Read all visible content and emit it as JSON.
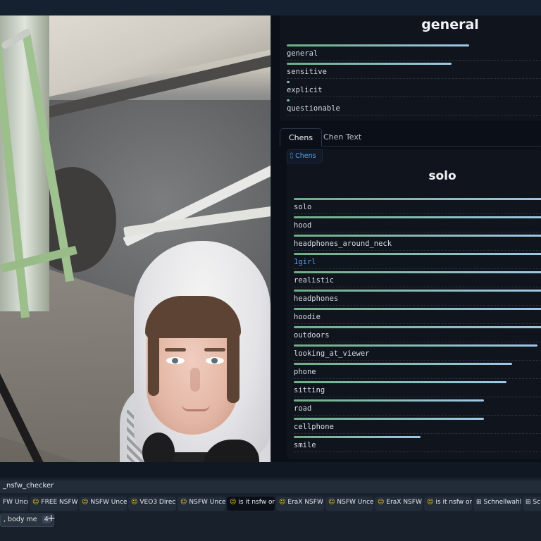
{
  "general_panel": {
    "title": "general",
    "ratings": [
      {
        "label": "general",
        "value": 0.72
      },
      {
        "label": "sensitive",
        "value": 0.65
      },
      {
        "label": "explicit",
        "value": 0.01
      },
      {
        "label": "questionable",
        "value": 0.01
      }
    ]
  },
  "tabs": [
    {
      "label": "Chens",
      "active": true
    },
    {
      "label": "Chen Text",
      "active": false
    }
  ],
  "chens_panel": {
    "chip": "Chens",
    "title": "solo",
    "tags": [
      {
        "label": "solo",
        "value": 1.0
      },
      {
        "label": "hood",
        "value": 1.0
      },
      {
        "label": "headphones_around_neck",
        "value": 1.0
      },
      {
        "label": "1girl",
        "value": 1.0,
        "link": true
      },
      {
        "label": "realistic",
        "value": 1.0
      },
      {
        "label": "headphones",
        "value": 1.0
      },
      {
        "label": "hoodie",
        "value": 1.0
      },
      {
        "label": "outdoors",
        "value": 1.0
      },
      {
        "label": "looking_at_viewer",
        "value": 0.96
      },
      {
        "label": "phone",
        "value": 0.86
      },
      {
        "label": "sitting",
        "value": 0.84
      },
      {
        "label": "road",
        "value": 0.75
      },
      {
        "label": "cellphone",
        "value": 0.75
      },
      {
        "label": "smile",
        "value": 0.5
      }
    ]
  },
  "colors": {
    "bar_start": "#6fae83",
    "bar_end": "#9fc7e6",
    "link": "#5aa3e8",
    "panel_bg": "#0f141d"
  },
  "taskbar": {
    "address": "_nsfw_checker",
    "tabs": [
      {
        "label": "FW Unce",
        "icon": "none",
        "partial": true
      },
      {
        "label": "FREE NSFW",
        "icon": "hugging-face-icon"
      },
      {
        "label": "NSFW Unce",
        "icon": "hugging-face-icon"
      },
      {
        "label": "VEO3 Direc",
        "icon": "hugging-face-icon"
      },
      {
        "label": "NSFW Unce",
        "icon": "hugging-face-icon"
      },
      {
        "label": "is it nsfw or",
        "icon": "hugging-face-icon",
        "active": true
      },
      {
        "label": "EraX NSFW",
        "icon": "hugging-face-icon"
      },
      {
        "label": "NSFW Unce",
        "icon": "hugging-face-icon"
      },
      {
        "label": "EraX NSFW",
        "icon": "hugging-face-icon"
      },
      {
        "label": "is it nsfw or",
        "icon": "hugging-face-icon"
      },
      {
        "label": "Schnellwahl",
        "icon": "grid-icon"
      },
      {
        "label": "Schne",
        "icon": "grid-icon"
      }
    ],
    "group_label": ", body me",
    "group_count": "4",
    "new_tab": "+"
  }
}
